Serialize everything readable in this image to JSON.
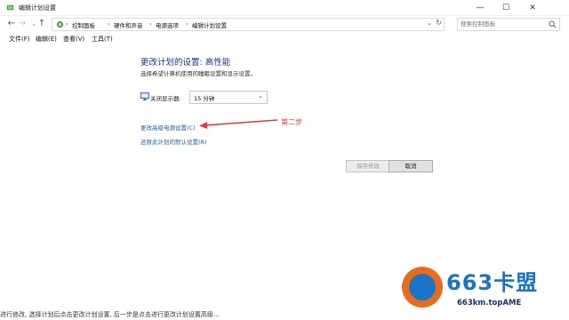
{
  "window": {
    "title": "编辑计划设置"
  },
  "breadcrumb": [
    "控制面板",
    "硬件和声音",
    "电源选项",
    "编辑计划设置"
  ],
  "search": {
    "placeholder": "搜索控制面板"
  },
  "menu": [
    "文件(F)",
    "编辑(E)",
    "查看(V)",
    "工具(T)"
  ],
  "main": {
    "heading": "更改计划的设置: 高性能",
    "subtext": "选择希望计算机使用的睡眠设置和显示设置。",
    "display_off_label": "关闭显示器:",
    "display_off_value": "15 分钟",
    "advanced_link": "更改高级电源设置(C)",
    "restore_link": "还原此计划的默认设置(R)",
    "annotation": "第二步",
    "save_button": "保存修改",
    "cancel_button": "取消"
  },
  "bottom_text": "进行修改, 选择计划后点击更改计划设置, 后一步是点击进行更改计划设置高级…",
  "watermark": {
    "brand": "663卡盟",
    "url": "663km.topAME"
  },
  "colors": {
    "heading": "#1e3287",
    "link": "#1a5fb4",
    "annotation": "#e23a3a",
    "logo_blue": "#1a73c8",
    "logo_orange": "#e86b1e"
  }
}
